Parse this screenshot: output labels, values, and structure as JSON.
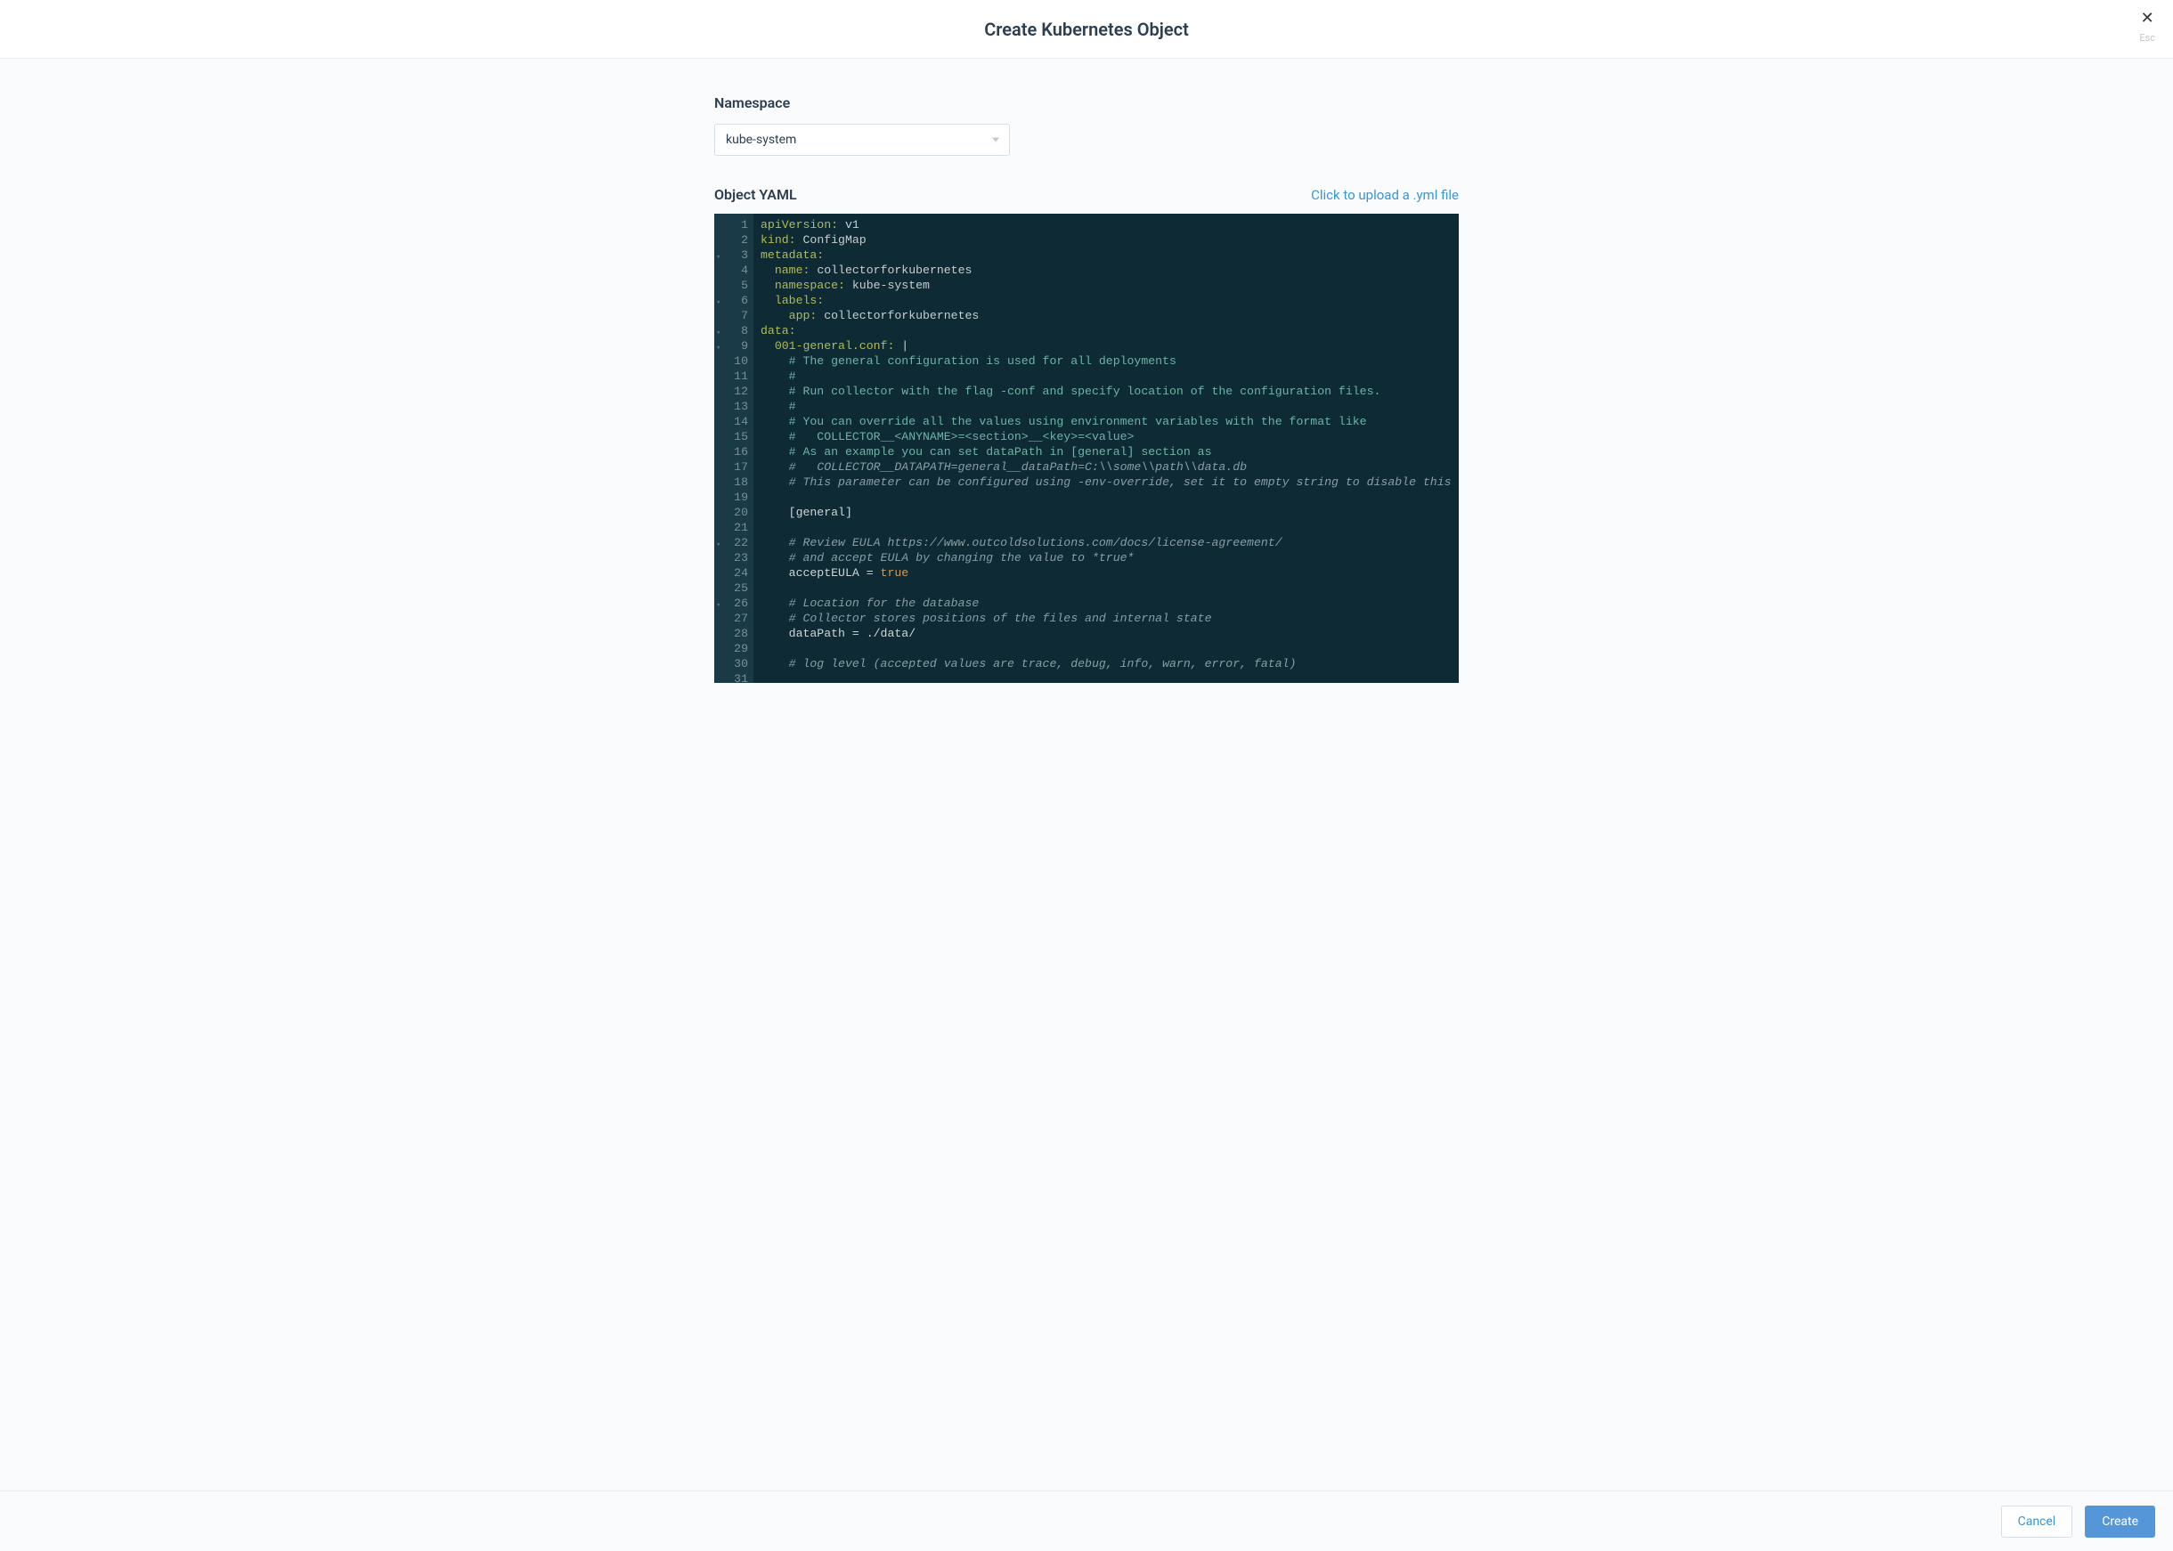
{
  "header": {
    "title": "Create Kubernetes Object",
    "close_hint": "Esc"
  },
  "form": {
    "namespace_label": "Namespace",
    "namespace_value": "kube-system",
    "yaml_label": "Object YAML",
    "upload_link": "Click to upload a .yml file"
  },
  "editor": {
    "lines": [
      {
        "n": 1,
        "fold": false,
        "segs": [
          {
            "cls": "key-top",
            "t": "apiVersion:"
          },
          {
            "cls": "val-default",
            "t": " v1"
          }
        ]
      },
      {
        "n": 2,
        "fold": false,
        "segs": [
          {
            "cls": "key-top",
            "t": "kind:"
          },
          {
            "cls": "val-default",
            "t": " ConfigMap"
          }
        ]
      },
      {
        "n": 3,
        "fold": true,
        "segs": [
          {
            "cls": "key-top",
            "t": "metadata:"
          }
        ]
      },
      {
        "n": 4,
        "fold": false,
        "segs": [
          {
            "cls": "val-default",
            "t": "  "
          },
          {
            "cls": "key-nested",
            "t": "name:"
          },
          {
            "cls": "val-default",
            "t": " collectorforkubernetes"
          }
        ]
      },
      {
        "n": 5,
        "fold": false,
        "segs": [
          {
            "cls": "val-default",
            "t": "  "
          },
          {
            "cls": "key-nested",
            "t": "namespace:"
          },
          {
            "cls": "val-default",
            "t": " kube-system"
          }
        ]
      },
      {
        "n": 6,
        "fold": true,
        "segs": [
          {
            "cls": "val-default",
            "t": "  "
          },
          {
            "cls": "key-nested",
            "t": "labels:"
          }
        ]
      },
      {
        "n": 7,
        "fold": false,
        "segs": [
          {
            "cls": "val-default",
            "t": "    "
          },
          {
            "cls": "key-nested",
            "t": "app:"
          },
          {
            "cls": "val-default",
            "t": " collectorforkubernetes"
          }
        ]
      },
      {
        "n": 8,
        "fold": true,
        "segs": [
          {
            "cls": "key-top",
            "t": "data:"
          }
        ]
      },
      {
        "n": 9,
        "fold": true,
        "segs": [
          {
            "cls": "val-default",
            "t": "  "
          },
          {
            "cls": "key-nested",
            "t": "001-general.conf:"
          },
          {
            "cls": "val-default",
            "t": " |"
          }
        ]
      },
      {
        "n": 10,
        "fold": false,
        "segs": [
          {
            "cls": "val-teal",
            "t": "    # The general configuration is used for all deployments"
          }
        ]
      },
      {
        "n": 11,
        "fold": false,
        "segs": [
          {
            "cls": "val-teal",
            "t": "    #"
          }
        ]
      },
      {
        "n": 12,
        "fold": false,
        "segs": [
          {
            "cls": "val-teal",
            "t": "    # Run collector with the flag -conf and specify location of the configuration files."
          }
        ]
      },
      {
        "n": 13,
        "fold": false,
        "segs": [
          {
            "cls": "val-teal",
            "t": "    #"
          }
        ]
      },
      {
        "n": 14,
        "fold": false,
        "segs": [
          {
            "cls": "val-teal",
            "t": "    # You can override all the values using environment variables with the format like"
          }
        ]
      },
      {
        "n": 15,
        "fold": false,
        "segs": [
          {
            "cls": "val-teal",
            "t": "    #   COLLECTOR__<ANYNAME>=<section>__<key>=<value>"
          }
        ]
      },
      {
        "n": 16,
        "fold": false,
        "segs": [
          {
            "cls": "val-teal",
            "t": "    # As an example you can set dataPath in [general] section as"
          }
        ]
      },
      {
        "n": 17,
        "fold": false,
        "segs": [
          {
            "cls": "val-italic-comment",
            "t": "    #   COLLECTOR__DATAPATH=general__dataPath=C:\\\\some\\\\path\\\\data.db"
          }
        ]
      },
      {
        "n": 18,
        "fold": false,
        "segs": [
          {
            "cls": "val-italic-comment",
            "t": "    # This parameter can be configured using -env-override, set it to empty string to disable this f"
          }
        ]
      },
      {
        "n": 19,
        "fold": false,
        "segs": []
      },
      {
        "n": 20,
        "fold": false,
        "segs": [
          {
            "cls": "val-white",
            "t": "    [general]"
          }
        ]
      },
      {
        "n": 21,
        "fold": false,
        "segs": []
      },
      {
        "n": 22,
        "fold": true,
        "segs": [
          {
            "cls": "val-italic-comment",
            "t": "    # Review EULA https://www.outcoldsolutions.com/docs/license-agreement/"
          }
        ]
      },
      {
        "n": 23,
        "fold": false,
        "segs": [
          {
            "cls": "val-italic-comment",
            "t": "    # and accept EULA by changing the value to *true*"
          }
        ]
      },
      {
        "n": 24,
        "fold": false,
        "segs": [
          {
            "cls": "val-white",
            "t": "    acceptEULA = "
          },
          {
            "cls": "val-true",
            "t": "true"
          }
        ]
      },
      {
        "n": 25,
        "fold": false,
        "segs": []
      },
      {
        "n": 26,
        "fold": true,
        "segs": [
          {
            "cls": "val-italic-comment",
            "t": "    # Location for the database"
          }
        ]
      },
      {
        "n": 27,
        "fold": false,
        "segs": [
          {
            "cls": "val-italic-comment",
            "t": "    # Collector stores positions of the files and internal state"
          }
        ]
      },
      {
        "n": 28,
        "fold": false,
        "segs": [
          {
            "cls": "val-white",
            "t": "    dataPath = ./data/"
          }
        ]
      },
      {
        "n": 29,
        "fold": false,
        "segs": []
      },
      {
        "n": 30,
        "fold": false,
        "segs": [
          {
            "cls": "val-italic-comment",
            "t": "    # log level (accepted values are trace, debug, info, warn, error, fatal)"
          }
        ]
      },
      {
        "n": 31,
        "fold": false,
        "segs": []
      }
    ]
  },
  "footer": {
    "cancel_label": "Cancel",
    "create_label": "Create"
  }
}
